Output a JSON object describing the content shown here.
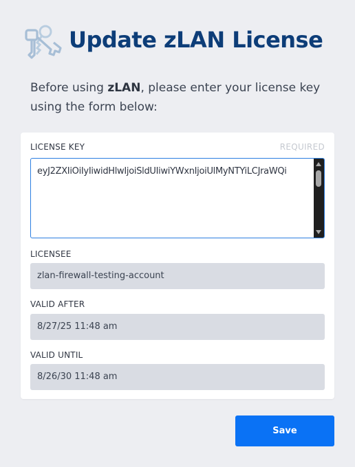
{
  "header": {
    "title": "Update zLAN License",
    "logo_icon": "keys-icon"
  },
  "intro": {
    "prefix": "Before using ",
    "product": "zLAN",
    "suffix": ", please enter your license key using the form below:"
  },
  "form": {
    "license_key": {
      "label": "LICENSE KEY",
      "required_label": "REQUIRED",
      "value": "eyJ2ZXIiOiIyIiwidHlwIjoiSldUIiwiYWxnIjoiUlMyNTYiLCJraWQi"
    },
    "licensee": {
      "label": "LICENSEE",
      "value": "zlan-firewall-testing-account"
    },
    "valid_after": {
      "label": "VALID AFTER",
      "value": "8/27/25 11:48 am"
    },
    "valid_until": {
      "label": "VALID UNTIL",
      "value": "8/26/30 11:48 am"
    }
  },
  "actions": {
    "save_label": "Save"
  },
  "colors": {
    "title": "#0d3d78",
    "accent": "#0a72f5",
    "focus_border": "#2a7de1",
    "background": "#edeef2",
    "readonly_field": "#d9dce3"
  }
}
